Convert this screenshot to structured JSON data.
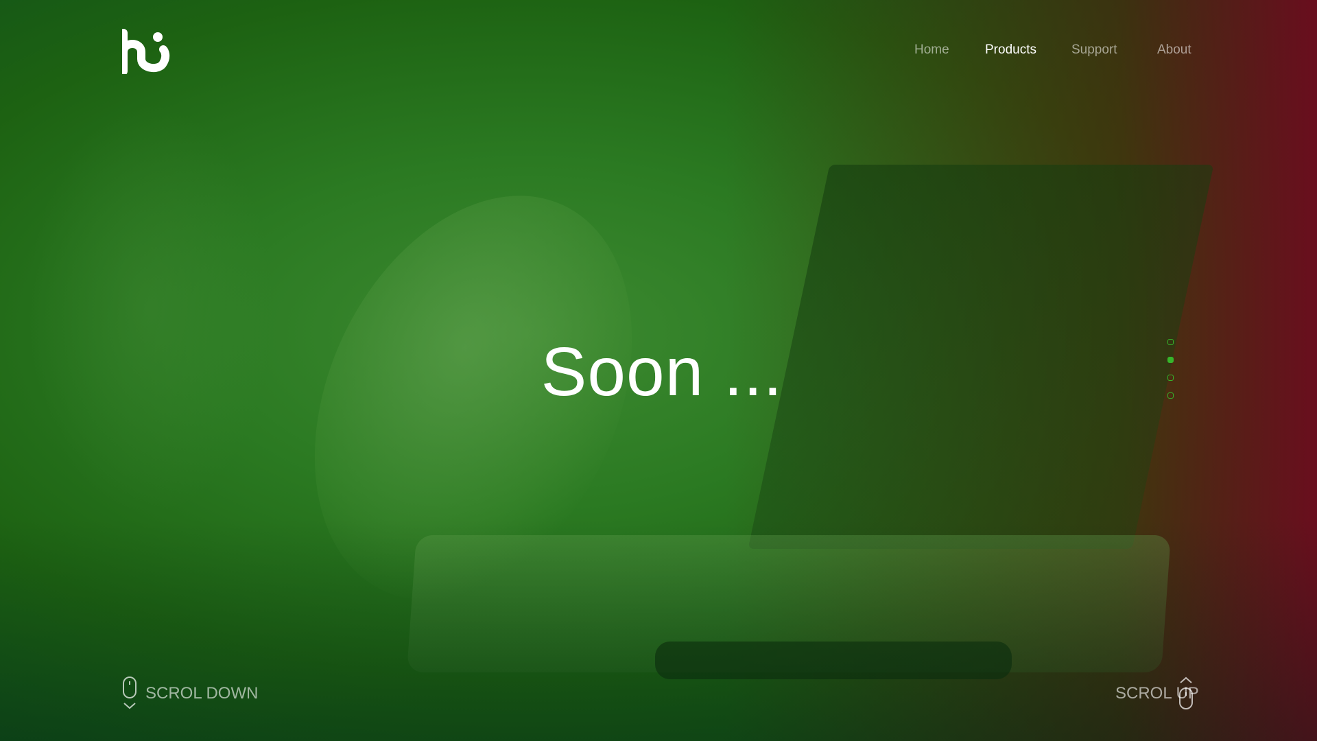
{
  "nav": {
    "items": [
      {
        "label": "Home",
        "active": false
      },
      {
        "label": "Products",
        "active": true
      },
      {
        "label": "Support",
        "active": false
      },
      {
        "label": "About",
        "active": false
      }
    ]
  },
  "hero": {
    "headline": "Soon ..."
  },
  "pager": {
    "count": 4,
    "active_index": 1
  },
  "scroll": {
    "down_label": "SCROL DOWN",
    "up_label": "SCROL UP"
  },
  "colors": {
    "accent": "#36b52b",
    "text": "#ffffff",
    "background_green": "#1d6212",
    "corner_red": "#6e0a1e"
  },
  "icons": {
    "logo": "brand-logo-icon",
    "mouse": "mouse-icon"
  }
}
